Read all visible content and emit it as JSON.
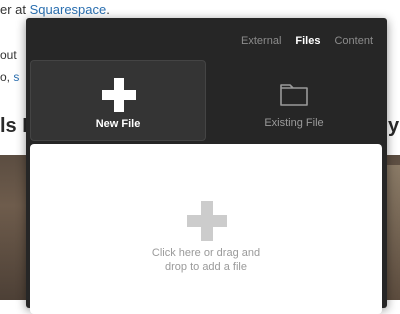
{
  "background": {
    "line1_prefix": "er at ",
    "line1_link": "Squarespace",
    "line1_suffix": ".",
    "line2": "out",
    "line3_prefix": "o, ",
    "line3_link": "s",
    "heading_left": "ls N",
    "heading_right": "y"
  },
  "dialog": {
    "tabs": [
      {
        "label": "External",
        "active": false
      },
      {
        "label": "Files",
        "active": true
      },
      {
        "label": "Content",
        "active": false
      }
    ],
    "options": {
      "new_file": "New File",
      "existing_file": "Existing File"
    },
    "dropzone": {
      "line1": "Click here or drag and",
      "line2": "drop to add a file"
    }
  },
  "icons": {
    "new_file": "plus-icon",
    "existing_file": "folder-icon",
    "dropzone": "plus-icon"
  },
  "colors": {
    "dialog_bg": "#262626",
    "selected_tile": "#343434",
    "link": "#2a6fb0",
    "dropzone_icon": "#cccccc"
  }
}
